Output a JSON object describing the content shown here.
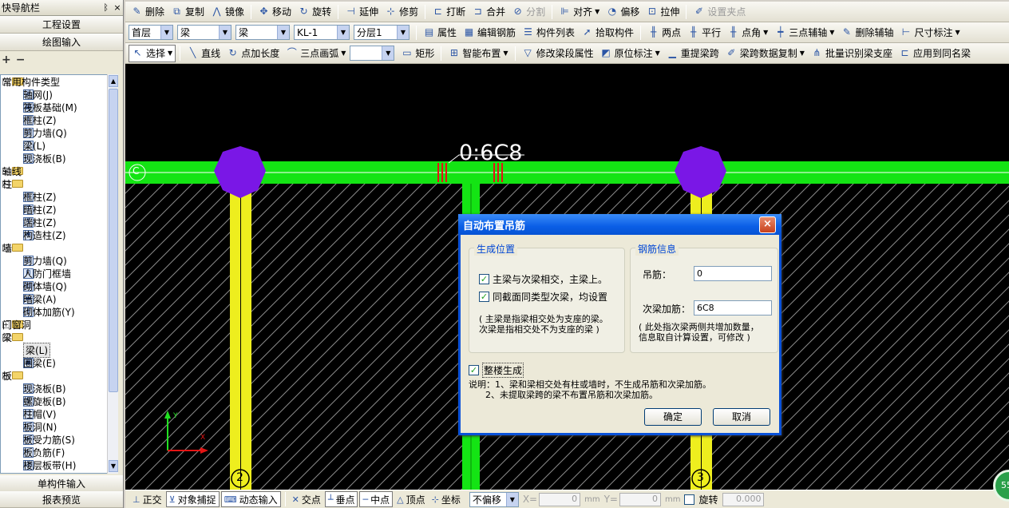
{
  "nav": {
    "title": "快导航栏",
    "pin": "ᛒ",
    "close": "×",
    "buttons": [
      "工程设置",
      "绘图输入"
    ],
    "bottom_buttons": [
      "单构件输入",
      "报表预览"
    ],
    "tree": [
      {
        "label": "常用构件类型",
        "level": 0,
        "type": "folder",
        "exp": "−"
      },
      {
        "label": "轴网(J)",
        "level": 1,
        "type": "leaf",
        "icon": "#"
      },
      {
        "label": "筏板基础(M)",
        "level": 1,
        "type": "leaf",
        "icon": "▦"
      },
      {
        "label": "框柱(Z)",
        "level": 1,
        "type": "leaf",
        "icon": "T"
      },
      {
        "label": "剪力墙(Q)",
        "level": 1,
        "type": "leaf",
        "icon": "▤"
      },
      {
        "label": "梁(L)",
        "level": 1,
        "type": "leaf",
        "icon": "⊤"
      },
      {
        "label": "现浇板(B)",
        "level": 1,
        "type": "leaf",
        "icon": "▭"
      },
      {
        "label": "轴线",
        "level": 0,
        "type": "folder",
        "exp": "+"
      },
      {
        "label": "柱",
        "level": 0,
        "type": "folder",
        "exp": "−"
      },
      {
        "label": "框柱(Z)",
        "level": 1,
        "type": "leaf",
        "icon": "T"
      },
      {
        "label": "暗柱(Z)",
        "level": 1,
        "type": "leaf",
        "icon": "T"
      },
      {
        "label": "端柱(Z)",
        "level": 1,
        "type": "leaf",
        "icon": "T"
      },
      {
        "label": "构造柱(Z)",
        "level": 1,
        "type": "leaf",
        "icon": "✱"
      },
      {
        "label": "墙",
        "level": 0,
        "type": "folder",
        "exp": "−"
      },
      {
        "label": "剪力墙(Q)",
        "level": 1,
        "type": "leaf",
        "icon": "▤"
      },
      {
        "label": "人防门框墙",
        "level": 1,
        "type": "leaf",
        "icon": "⊓"
      },
      {
        "label": "砌体墙(Q)",
        "level": 1,
        "type": "leaf",
        "icon": "▥"
      },
      {
        "label": "暗梁(A)",
        "level": 1,
        "type": "leaf",
        "icon": "▬"
      },
      {
        "label": "砌体加筋(Y)",
        "level": 1,
        "type": "leaf",
        "icon": "┼"
      },
      {
        "label": "门窗洞",
        "level": 0,
        "type": "folder",
        "exp": "+"
      },
      {
        "label": "梁",
        "level": 0,
        "type": "folder",
        "exp": "−"
      },
      {
        "label": "梁(L)",
        "level": 1,
        "type": "leaf",
        "icon": "⊤",
        "selected": true
      },
      {
        "label": "圈梁(E)",
        "level": 1,
        "type": "leaf",
        "icon": "▣"
      },
      {
        "label": "板",
        "level": 0,
        "type": "folder",
        "exp": "−"
      },
      {
        "label": "现浇板(B)",
        "level": 1,
        "type": "leaf",
        "icon": "▭"
      },
      {
        "label": "螺旋板(B)",
        "level": 1,
        "type": "leaf",
        "icon": "S"
      },
      {
        "label": "柱帽(V)",
        "level": 1,
        "type": "leaf",
        "icon": "▽"
      },
      {
        "label": "板洞(N)",
        "level": 1,
        "type": "leaf",
        "icon": "□"
      },
      {
        "label": "板受力筋(S)",
        "level": 1,
        "type": "leaf",
        "icon": "⇌"
      },
      {
        "label": "板负筋(F)",
        "level": 1,
        "type": "leaf",
        "icon": "⌐"
      },
      {
        "label": "楼层板带(H)",
        "level": 1,
        "type": "leaf",
        "icon": "Ш"
      }
    ]
  },
  "toolbar1": [
    {
      "label": "删除",
      "icon": "✎"
    },
    {
      "label": "复制",
      "icon": "⧉"
    },
    {
      "label": "镜像",
      "icon": "⋀"
    },
    {
      "sep": true
    },
    {
      "label": "移动",
      "icon": "✥"
    },
    {
      "label": "旋转",
      "icon": "↻"
    },
    {
      "sep": true
    },
    {
      "label": "延伸",
      "icon": "⊣"
    },
    {
      "label": "修剪",
      "icon": "⊹"
    },
    {
      "sep": true
    },
    {
      "label": "打断",
      "icon": "⊏"
    },
    {
      "label": "合并",
      "icon": "⊐"
    },
    {
      "label": "分割",
      "icon": "⊘",
      "disabled": true
    },
    {
      "sep": true
    },
    {
      "label": "对齐",
      "icon": "⊫",
      "dropdown": true
    },
    {
      "label": "偏移",
      "icon": "◔"
    },
    {
      "label": "拉伸",
      "icon": "⊡"
    },
    {
      "sep": true
    },
    {
      "label": "设置夹点",
      "icon": "✐",
      "disabled": true
    }
  ],
  "toolbar2": {
    "combos": [
      {
        "value": "首层",
        "width": 56
      },
      {
        "value": "梁",
        "width": 68
      },
      {
        "value": "梁",
        "width": 68
      },
      {
        "value": "KL-1",
        "width": 70
      },
      {
        "value": "分层1",
        "width": 70
      }
    ],
    "buttons": [
      {
        "label": "属性",
        "icon": "▤"
      },
      {
        "label": "编辑钢筋",
        "icon": "▦"
      },
      {
        "label": "构件列表",
        "icon": "☰"
      },
      {
        "label": "拾取构件",
        "icon": "➚"
      },
      {
        "sep": true
      },
      {
        "label": "两点",
        "icon": "╫"
      },
      {
        "label": "平行",
        "icon": "╫"
      },
      {
        "label": "点角",
        "icon": "╫",
        "dropdown": true
      },
      {
        "label": "三点辅轴",
        "icon": "┿",
        "dropdown": true
      },
      {
        "label": "删除辅轴",
        "icon": "✎"
      },
      {
        "label": "尺寸标注",
        "icon": "⊢",
        "dropdown": true
      }
    ]
  },
  "toolbar3": {
    "buttons": [
      {
        "label": "选择",
        "icon": "↖",
        "dropdown": true,
        "pressed": true
      },
      {
        "sep": true
      },
      {
        "label": "直线",
        "icon": "╲"
      },
      {
        "label": "点加长度",
        "icon": "↻"
      },
      {
        "label": "三点画弧",
        "icon": "⌒",
        "dropdown": true
      },
      {
        "combo": true,
        "value": "",
        "width": 56
      },
      {
        "label": "矩形",
        "icon": "▭"
      },
      {
        "sep": true
      },
      {
        "label": "智能布置",
        "icon": "⊞",
        "dropdown": true
      },
      {
        "sep": true
      },
      {
        "label": "修改梁段属性",
        "icon": "▽"
      },
      {
        "label": "原位标注",
        "icon": "◩",
        "dropdown": true
      },
      {
        "label": "重提梁跨",
        "icon": "▁"
      },
      {
        "label": "梁跨数据复制",
        "icon": "✐",
        "dropdown": true
      },
      {
        "label": "批量识别梁支座",
        "icon": "⋔"
      },
      {
        "label": "应用到同名梁",
        "icon": "⊏"
      }
    ]
  },
  "canvas": {
    "annotation": "0:6C8",
    "axis_labels": [
      "2",
      "3"
    ],
    "axis_start_label": "C",
    "ucs": {
      "x": "X",
      "y": "Y"
    },
    "colors": {
      "beam": "#14e414",
      "column": "#7a17e6",
      "yellow_beam": "#eeee1e",
      "hatch": "#8a8a8a",
      "background": "#000000",
      "hanger": "#e41414"
    }
  },
  "dialog": {
    "title": "自动布置吊筋",
    "close": "×",
    "position_group": {
      "legend": "生成位置",
      "option1": {
        "label": "主梁与次梁相交，主梁上。",
        "checked": true
      },
      "option2": {
        "label": "同截面同类型次梁，均设置",
        "checked": true
      },
      "note": "( 主梁是指梁相交处为支座的梁。\n次梁是指相交处不为支座的梁 )"
    },
    "rebar_group": {
      "legend": "钢筋信息",
      "hanger_label": "吊筋：",
      "hanger_value": "0",
      "secondary_label": "次梁加筋：",
      "secondary_value": "6C8",
      "note": "( 此处指次梁两侧共增加数量，\n信息取自计算设置，可修改 )"
    },
    "whole_floor": {
      "label": "整楼生成",
      "checked": true
    },
    "explain": "说明：1、梁和梁相交处有柱或墙时，不生成吊筋和次梁加筋。\n      2、未提取梁跨的梁不布置吊筋和次梁加筋。",
    "ok": "确定",
    "cancel": "取消"
  },
  "status": {
    "items": [
      {
        "label": "正交",
        "icon": "⊥"
      },
      {
        "label": "对象捕捉",
        "icon": "⊻",
        "on": true
      },
      {
        "label": "动态输入",
        "icon": "⌨",
        "on": true
      },
      {
        "sep": true
      },
      {
        "label": "交点",
        "icon": "✕"
      },
      {
        "label": "垂点",
        "icon": "┴",
        "on": true
      },
      {
        "label": "中点",
        "icon": "─",
        "on": true
      },
      {
        "label": "顶点",
        "icon": "△"
      },
      {
        "label": "坐标",
        "icon": "⊹"
      }
    ],
    "offset_mode": "不偏移",
    "x_label": "X=",
    "x_value": "0",
    "y_label": "Y=",
    "y_value": "0",
    "unit": "mm",
    "rotate_label": "旋转",
    "rotate_value": "0.000",
    "badge": "55"
  }
}
